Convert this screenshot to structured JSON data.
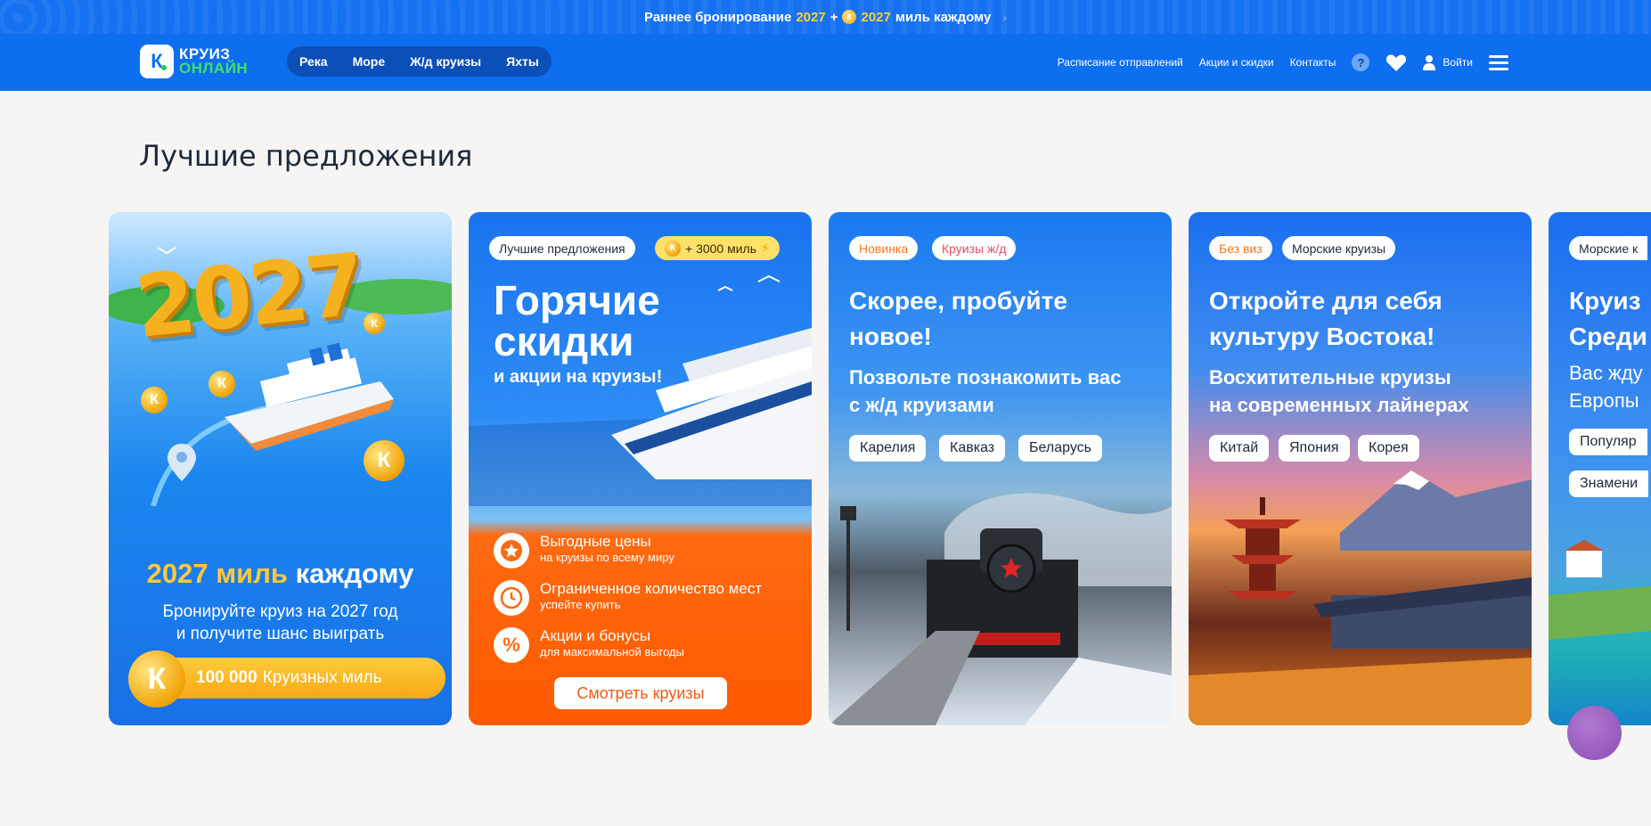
{
  "promo": {
    "text1": "Раннее бронирование",
    "year1": "2027",
    "plus": "+",
    "year2": "2027",
    "text2": "миль каждому",
    "chevron": "›"
  },
  "header": {
    "logo": {
      "line1": "КРУИЗ",
      "line2": "ОНЛАЙН",
      "mark": "К"
    },
    "nav": [
      "Река",
      "Море",
      "Ж/д круизы",
      "Яхты"
    ],
    "links": [
      "Расписание отправлений",
      "Акции и скидки",
      "Контакты"
    ],
    "help": "?",
    "login": "Войти"
  },
  "section_title": "Лучшие предложения",
  "cards": {
    "c1": {
      "year": "2027",
      "coin_letter": "К",
      "miles_yellow": "2027 миль",
      "miles_white": "каждому",
      "desc1": "Бронируйте круиз на 2027 год",
      "desc2": "и получите шанс выиграть",
      "bar_bold": "100 000",
      "bar_text": "Круизных миль"
    },
    "c2": {
      "tag1": "Лучшие предложения",
      "tag2": "+ 3000 миль",
      "title1": "Горячие",
      "title2": "скидки",
      "subtitle": "и акции на круизы!",
      "items": [
        {
          "t1": "Выгодные цены",
          "t2": "на круизы по всему миру",
          "icon": "star-icon"
        },
        {
          "t1": "Ограниченное количество мест",
          "t2": "успейте купить",
          "icon": "clock-icon"
        },
        {
          "t1": "Акции и бонусы",
          "t2": "для максимальной выгоды",
          "icon": "percent-icon"
        }
      ],
      "button": "Смотреть круизы"
    },
    "c3": {
      "tag1": "Новинка",
      "tag2": "Круизы ж/д",
      "title1": "Скорее, пробуйте",
      "title2": "новое!",
      "sub1": "Позвольте познакомить вас",
      "sub2": "с ж/д круизами",
      "chips": [
        "Карелия",
        "Кавказ",
        "Беларусь"
      ]
    },
    "c4": {
      "tag1": "Без виз",
      "tag2": "Морские круизы",
      "title1": "Откройте для себя",
      "title2": "культуру Востока!",
      "sub1": "Восхитительные круизы",
      "sub2": "на современных лайнерах",
      "chips": [
        "Китай",
        "Япония",
        "Корея"
      ]
    },
    "c5": {
      "tag1": "Морские к",
      "title1": "Круиз",
      "title2": "Среди",
      "sub1": "Вас жду",
      "sub2": "Европы",
      "chips": [
        "Популяр",
        "Знамени"
      ]
    }
  },
  "colors": {
    "brand": "#0d6ef0",
    "accent_yellow": "#ffc93a",
    "orange": "#ff5a00"
  }
}
